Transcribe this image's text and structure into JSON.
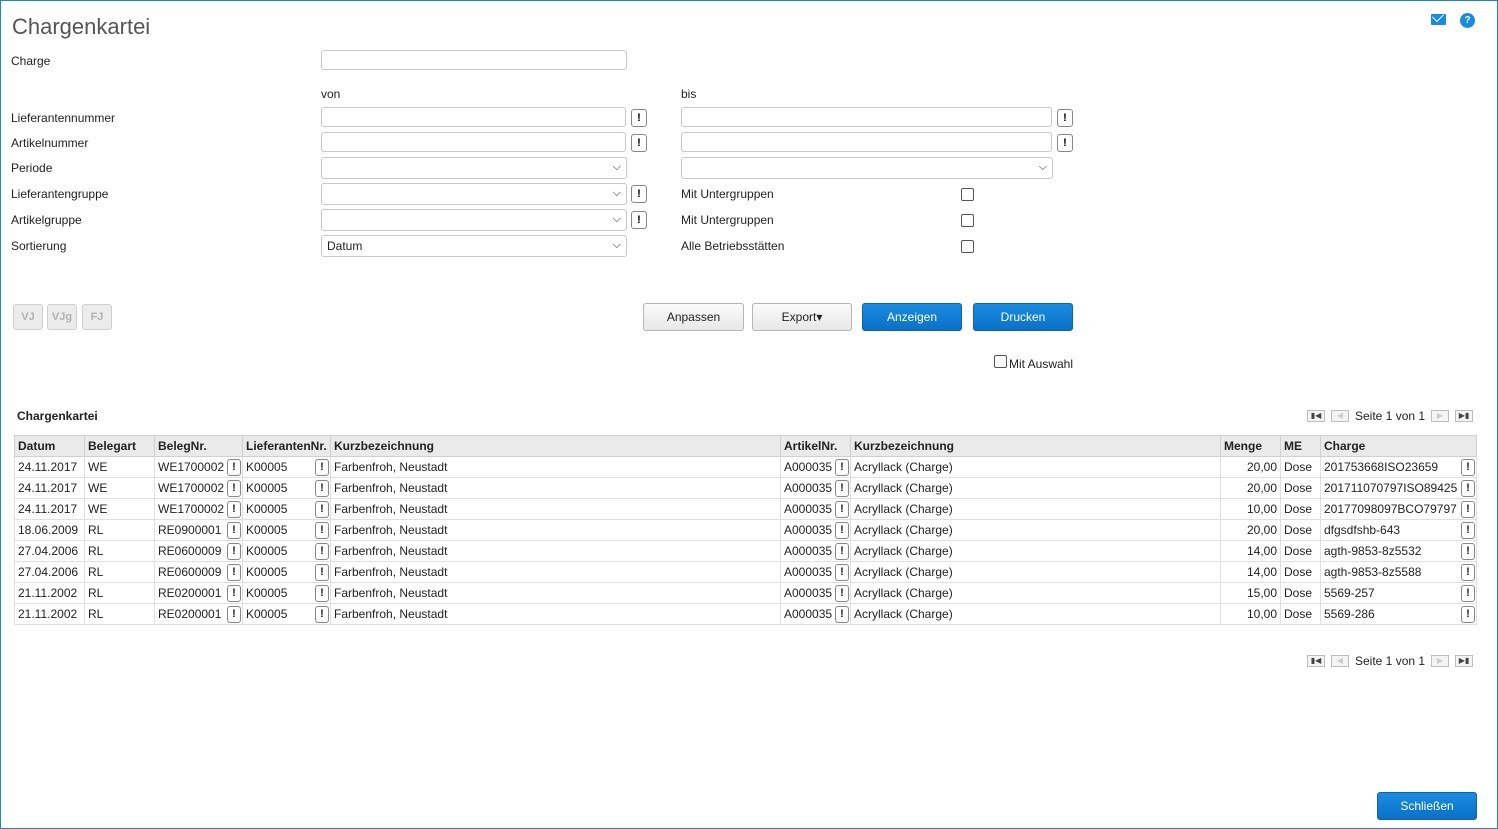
{
  "page": {
    "title": "Chargenkartei"
  },
  "icons": {
    "mail": "mail-icon",
    "help": "help-icon"
  },
  "form": {
    "charge_label": "Charge",
    "charge_value": "",
    "von": "von",
    "bis": "bis",
    "lieferantennummer_label": "Lieferantennummer",
    "artikelnummer_label": "Artikelnummer",
    "periode_label": "Periode",
    "lieferantengruppe_label": "Lieferantengruppe",
    "artikelgruppe_label": "Artikelgruppe",
    "sortierung_label": "Sortierung",
    "sortierung_value": "Datum",
    "mit_untergruppen_1": "Mit Untergruppen",
    "mit_untergruppen_2": "Mit Untergruppen",
    "alle_betriebsstaetten": "Alle Betriebsstätten",
    "ex_glyph": "!"
  },
  "buttons": {
    "vj": "VJ",
    "vjg": "VJg",
    "fj": "FJ",
    "anpassen": "Anpassen",
    "export": "Export▾",
    "anzeigen": "Anzeigen",
    "drucken": "Drucken",
    "mit_auswahl": "Mit Auswahl",
    "schliessen": "Schließen"
  },
  "grid": {
    "caption": "Chargenkartei",
    "pager_text": "Seite 1 von 1",
    "columns": [
      "Datum",
      "Belegart",
      "BelegNr.",
      "LieferantenNr.",
      "Kurzbezeichnung",
      "ArtikelNr.",
      "Kurzbezeichnung",
      "Menge",
      "ME",
      "Charge"
    ],
    "rows": [
      [
        "24.11.2017",
        "WE",
        "WE1700002",
        "K00005",
        "Farbenfroh, Neustadt",
        "A000035",
        "Acryllack (Charge)",
        "20,00",
        "Dose",
        "201753668ISO23659"
      ],
      [
        "24.11.2017",
        "WE",
        "WE1700002",
        "K00005",
        "Farbenfroh, Neustadt",
        "A000035",
        "Acryllack (Charge)",
        "20,00",
        "Dose",
        "201711070797ISO89425"
      ],
      [
        "24.11.2017",
        "WE",
        "WE1700002",
        "K00005",
        "Farbenfroh, Neustadt",
        "A000035",
        "Acryllack (Charge)",
        "10,00",
        "Dose",
        "20177098097BCO79797"
      ],
      [
        "18.06.2009",
        "RL",
        "RE0900001",
        "K00005",
        "Farbenfroh, Neustadt",
        "A000035",
        "Acryllack (Charge)",
        "20,00",
        "Dose",
        "dfgsdfshb-643"
      ],
      [
        "27.04.2006",
        "RL",
        "RE0600009",
        "K00005",
        "Farbenfroh, Neustadt",
        "A000035",
        "Acryllack (Charge)",
        "14,00",
        "Dose",
        "agth-9853-8z5532"
      ],
      [
        "27.04.2006",
        "RL",
        "RE0600009",
        "K00005",
        "Farbenfroh, Neustadt",
        "A000035",
        "Acryllack (Charge)",
        "14,00",
        "Dose",
        "agth-9853-8z5588"
      ],
      [
        "21.11.2002",
        "RL",
        "RE0200001",
        "K00005",
        "Farbenfroh, Neustadt",
        "A000035",
        "Acryllack (Charge)",
        "15,00",
        "Dose",
        "5569-257"
      ],
      [
        "21.11.2002",
        "RL",
        "RE0200001",
        "K00005",
        "Farbenfroh, Neustadt",
        "A000035",
        "Acryllack (Charge)",
        "10,00",
        "Dose",
        "5569-286"
      ]
    ]
  }
}
